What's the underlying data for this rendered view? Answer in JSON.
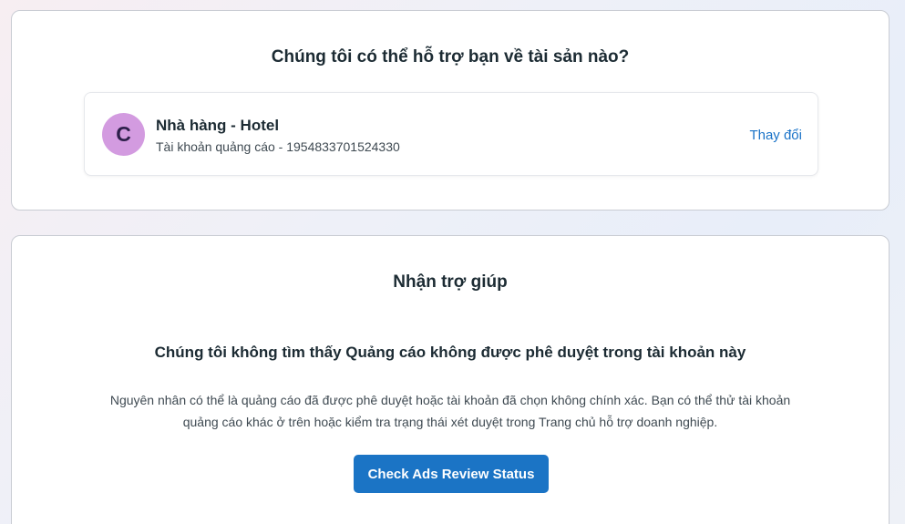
{
  "asset_section": {
    "title": "Chúng tôi có thể hỗ trợ bạn về tài sản nào?",
    "asset": {
      "avatar_letter": "C",
      "avatar_color": "#d39be0",
      "name": "Nhà hàng - Hotel",
      "subtitle": "Tài khoản quảng cáo - 1954833701524330"
    },
    "change_label": "Thay đổi"
  },
  "help_section": {
    "title": "Nhận trợ giúp",
    "heading": "Chúng tôi không tìm thấy Quảng cáo không được phê duyệt trong tài khoản này",
    "body": "Nguyên nhân có thể là quảng cáo đã được phê duyệt hoặc tài khoản đã chọn không chính xác. Bạn có thể thử tài khoản quảng cáo khác ở trên hoặc kiểm tra trạng thái xét duyệt trong Trang chủ hỗ trợ doanh nghiệp.",
    "button_label": "Check Ads Review Status",
    "button_color": "#1b74c5"
  },
  "colors": {
    "link": "#1a73c8",
    "text_primary": "#1c2b33"
  }
}
